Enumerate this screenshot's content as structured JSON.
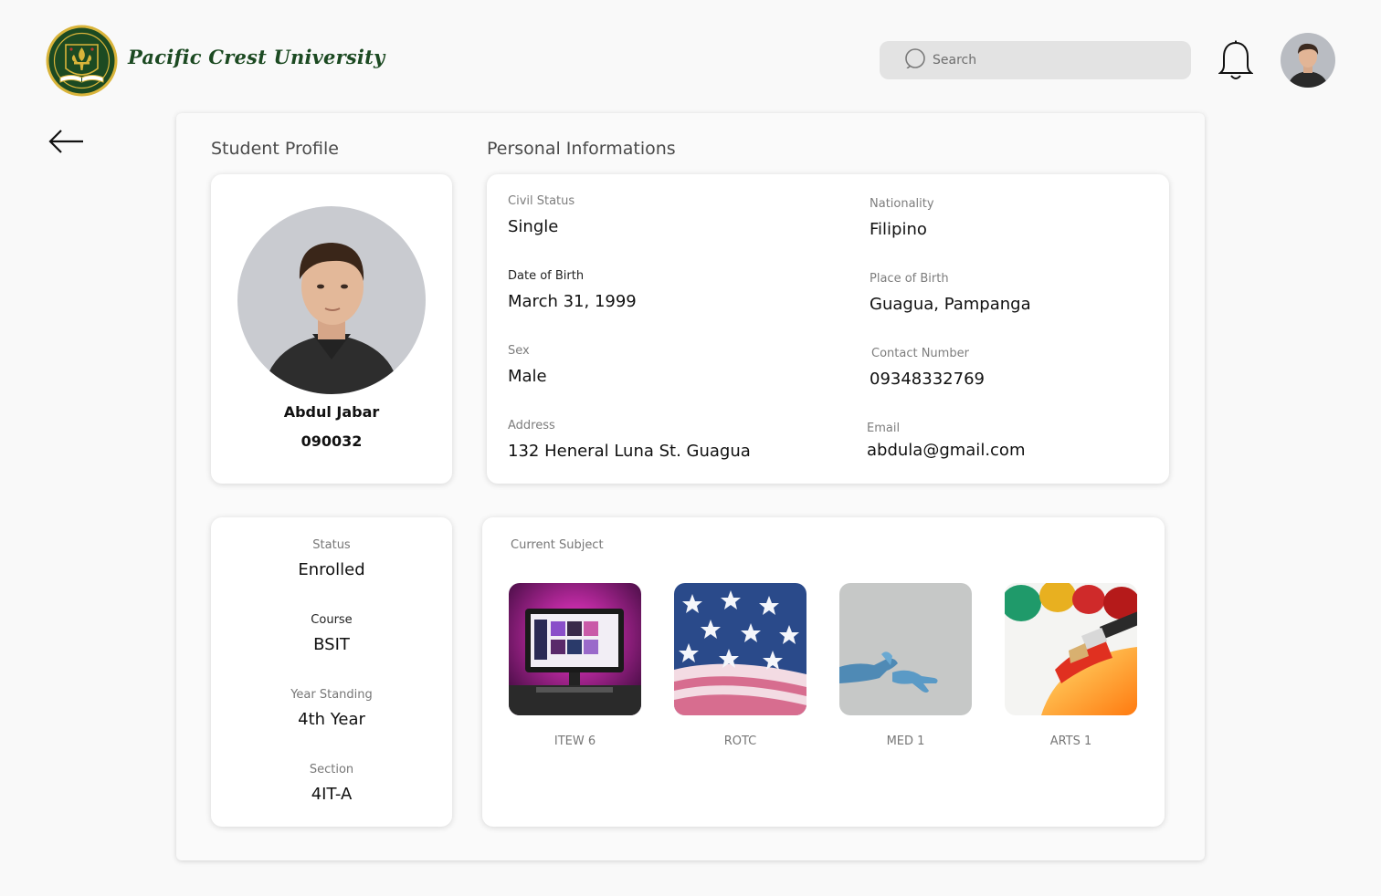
{
  "header": {
    "university_name": "Pacific Crest University",
    "search_placeholder": "Search"
  },
  "profile": {
    "section_title": "Student Profile",
    "name": "Abdul Jabar",
    "id": "090032"
  },
  "personal": {
    "section_title": "Personal Informations",
    "fields": [
      {
        "label": "Civil Status",
        "value": "Single"
      },
      {
        "label": "Nationality",
        "value": "Filipino"
      },
      {
        "label": "Date of Birth",
        "value": "March 31, 1999"
      },
      {
        "label": "Place of Birth",
        "value": "Guagua, Pampanga"
      },
      {
        "label": "Sex",
        "value": "Male"
      },
      {
        "label": "Contact Number",
        "value": "09348332769"
      },
      {
        "label": "Address",
        "value": "132 Heneral Luna St. Guagua"
      },
      {
        "label": "Email",
        "value": "abdula@gmail.com"
      }
    ]
  },
  "enrollment": {
    "items": [
      {
        "label": "Status",
        "value": "Enrolled"
      },
      {
        "label": "Course",
        "value": "BSIT"
      },
      {
        "label": "Year Standing",
        "value": "4th Year"
      },
      {
        "label": "Section",
        "value": "4IT-A"
      }
    ]
  },
  "subjects": {
    "title": "Current Subject",
    "items": [
      {
        "label": "ITEW 6",
        "icon": "computer-desk-photo"
      },
      {
        "label": "ROTC",
        "icon": "us-flag-photo"
      },
      {
        "label": "MED 1",
        "icon": "gloved-hands-photo"
      },
      {
        "label": "ARTS 1",
        "icon": "paint-brush-photo"
      }
    ]
  },
  "colors": {
    "brand_green": "#1c4a22",
    "logo_gold": "#d9b43a",
    "search_bg": "#e3e3e3"
  }
}
